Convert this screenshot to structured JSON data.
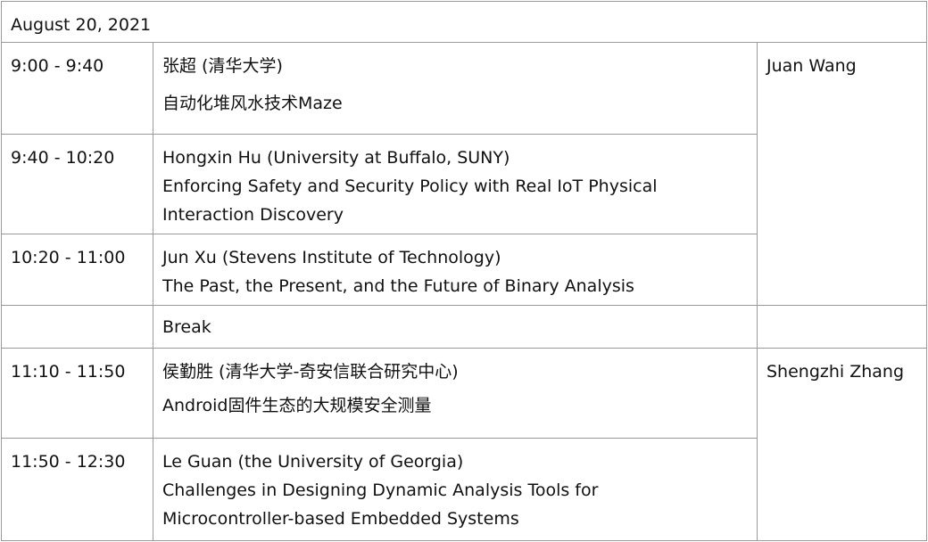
{
  "date": "August 20, 2021",
  "sessions": [
    {
      "time": "9:00 - 9:40",
      "speaker": "张超 (清华大学)",
      "title_lines": [
        "自动化堆风水技术Maze"
      ]
    },
    {
      "time": "9:40 - 10:20",
      "speaker": "Hongxin Hu (University at Buffalo, SUNY)",
      "title_lines": [
        "Enforcing Safety and Security Policy with Real IoT Physical",
        "Interaction Discovery"
      ]
    },
    {
      "time": "10:20 - 11:00",
      "speaker": "Jun Xu (Stevens Institute of Technology)",
      "title_lines": [
        "The Past, the Present, and the Future of Binary Analysis"
      ]
    },
    {
      "time": "11:10 - 11:50",
      "speaker": "侯勤胜 (清华大学-奇安信联合研究中心)",
      "title_lines": [
        "Android固件生态的大规模安全测量"
      ]
    },
    {
      "time": "11:50 - 12:30",
      "speaker": "Le Guan (the University of Georgia)",
      "title_lines": [
        "Challenges in Designing Dynamic Analysis Tools for",
        "Microcontroller-based Embedded Systems"
      ]
    }
  ],
  "break_label": "Break",
  "chairs": [
    "Juan Wang",
    "Shengzhi Zhang"
  ]
}
